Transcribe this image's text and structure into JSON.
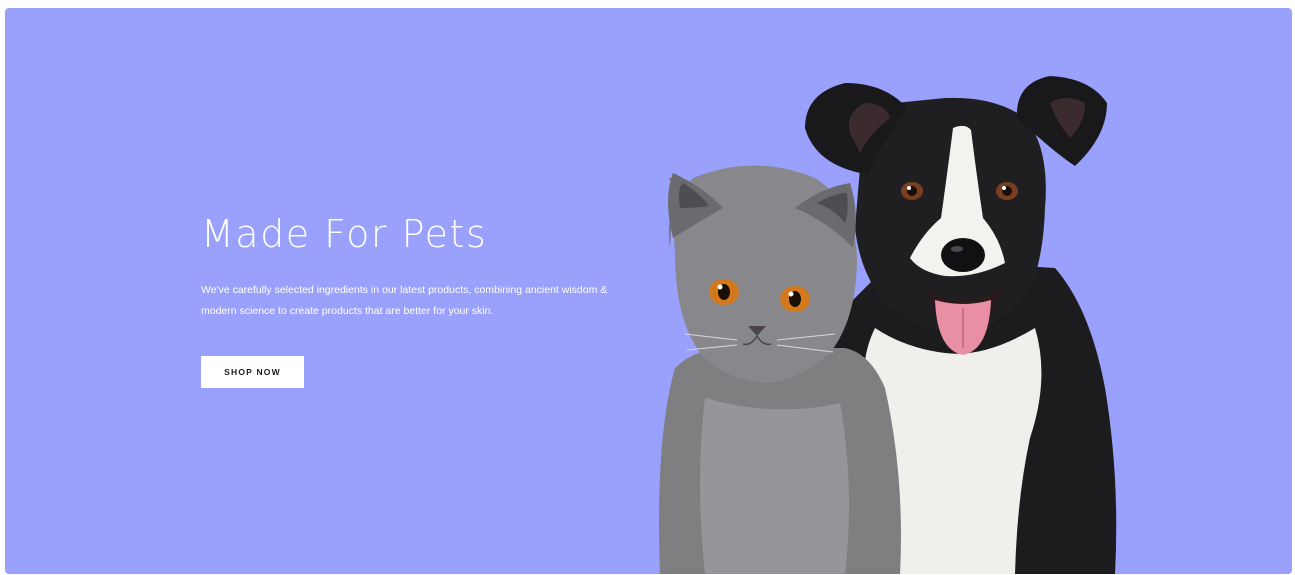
{
  "hero": {
    "title": "Made For Pets",
    "description": "We've carefully selected ingredients in our latest products, combining ancient wisdom & modern science to create products that are better for your skin.",
    "cta_label": "SHOP NOW",
    "background_color": "#9aa1fd",
    "image": {
      "subjects": [
        "grey cat",
        "black and white border collie dog"
      ]
    }
  }
}
